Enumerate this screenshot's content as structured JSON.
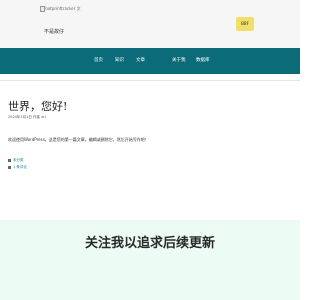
{
  "header": {
    "logo_alt": "footprinttracker 文",
    "site_title": "不是故仔",
    "button_label": "BBF"
  },
  "nav": {
    "items": [
      "首页",
      "知识",
      "文章",
      "关于我",
      "数据库"
    ]
  },
  "post": {
    "title": "世界，您好!",
    "meta_date": "2024年3月1日 作者",
    "meta_author": "eLi",
    "body": "欢迎使用WordPress。这是您的第一篇文章。编辑或删除它，然后开始写作吧！",
    "tags": [
      "未分类",
      "1 条评论"
    ]
  },
  "footer": {
    "headline": "关注我以追求后续更新"
  },
  "colors": {
    "nav_bg": "#0c6b78",
    "header_bg": "#f6f6f6",
    "button_bg": "#f0e06a",
    "footer_bg": "#ecfbf4",
    "link": "#0a7a8b"
  }
}
